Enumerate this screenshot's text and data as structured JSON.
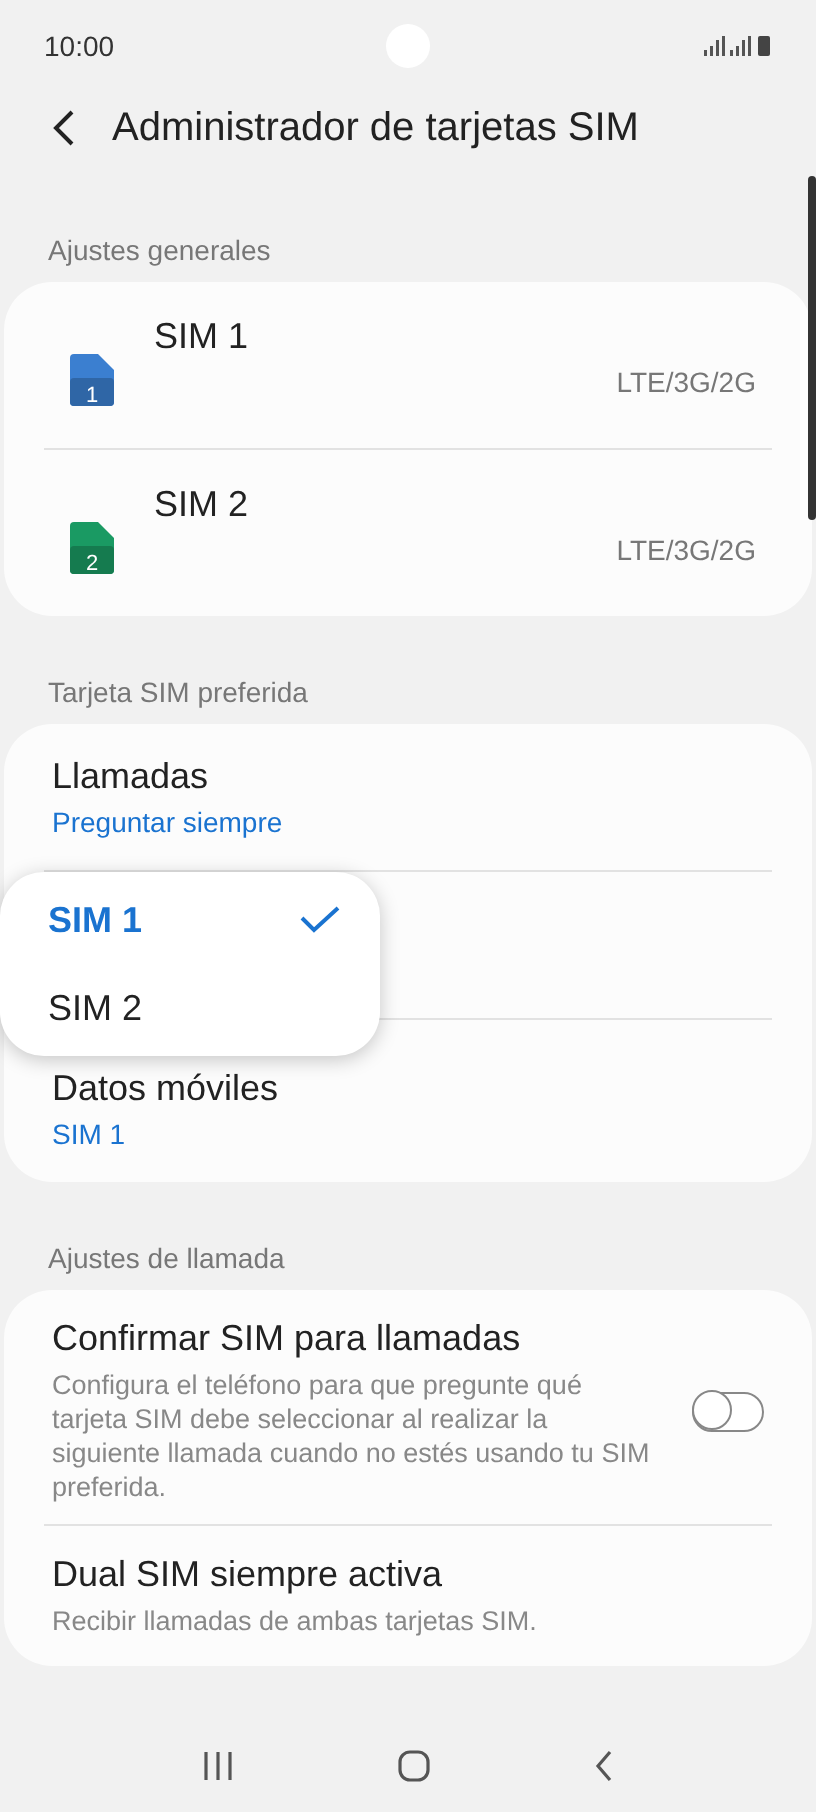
{
  "status_bar": {
    "time": "10:00"
  },
  "header": {
    "title": "Administrador de tarjetas SIM"
  },
  "sections": [
    {
      "title": "Ajustes generales",
      "items": [
        {
          "kind": "sim",
          "title": "SIM 1",
          "slot": "1",
          "color": "#3b7fd0",
          "network": "LTE/3G/2G"
        },
        {
          "kind": "sim",
          "title": "SIM 2",
          "slot": "2",
          "color": "#1a9a63",
          "network": "LTE/3G/2G"
        }
      ]
    },
    {
      "title": "Tarjeta SIM preferida",
      "items": [
        {
          "kind": "choice",
          "title": "Llamadas",
          "value": "Preguntar siempre"
        },
        {
          "kind": "menu",
          "options": [
            {
              "label": "SIM 1",
              "selected": true
            },
            {
              "label": "SIM 2",
              "selected": false
            }
          ]
        },
        {
          "kind": "choice",
          "title": "Datos móviles",
          "value": "SIM 1"
        }
      ]
    },
    {
      "title": "Ajustes de llamada",
      "items": [
        {
          "kind": "toggle",
          "title": "Confirmar SIM para llamadas",
          "description": "Configura el teléfono para que pregunte qué tarjeta SIM debe seleccionar al realizar la siguiente llamada cuando no estés usando tu SIM preferida.",
          "on": false
        },
        {
          "kind": "text",
          "title": "Dual SIM siempre activa",
          "description": "Recibir llamadas de ambas tarjetas SIM."
        }
      ]
    }
  ]
}
